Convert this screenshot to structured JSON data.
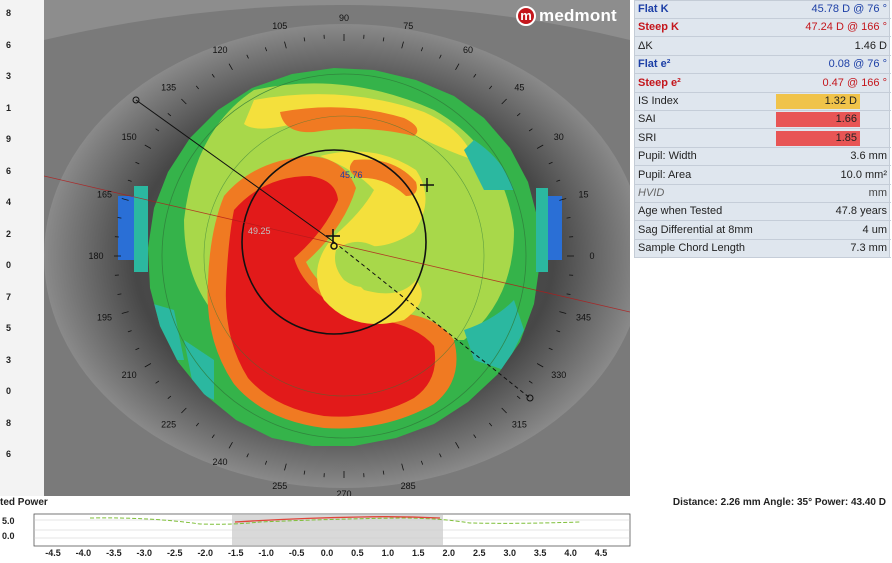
{
  "brand": {
    "logo_letter": "m",
    "name": "medmont"
  },
  "left_scale": [
    "8",
    "6",
    "3",
    "1",
    "9",
    "6",
    "4",
    "2",
    "0",
    "7",
    "5",
    "3",
    "0",
    "8",
    "6"
  ],
  "topography": {
    "axis_degrees": [
      "90",
      "105",
      "75",
      "120",
      "60",
      "135",
      "45",
      "150",
      "30",
      "165",
      "15",
      "180",
      "0",
      "195",
      "345",
      "210",
      "330",
      "225",
      "315",
      "240",
      "255",
      "270",
      "285"
    ],
    "value_labels": [
      "45.76",
      "49.25"
    ],
    "colors": {
      "red": "#e21a1a",
      "orange": "#f07a22",
      "yellow": "#f4e03c",
      "light_green": "#a8d84a",
      "green": "#35b34a",
      "teal": "#2bb8a0",
      "blue": "#2a6fd6"
    }
  },
  "stats": [
    {
      "label": "Flat K",
      "value": "45.78 D @ 76 °",
      "label_color": "#1c3fa6",
      "value_color": "#1c3fa6",
      "bold": true
    },
    {
      "label": "Steep K",
      "value": "47.24 D @ 166 °",
      "label_color": "#c4161c",
      "value_color": "#c4161c",
      "bold": true
    },
    {
      "label": "ΔK",
      "value": "1.46 D",
      "label_color": "#222222",
      "value_color": "#222222",
      "bold": false
    },
    {
      "label": "Flat e²",
      "value": "0.08 @ 76 °",
      "label_color": "#1c3fa6",
      "value_color": "#1c3fa6",
      "bold": true
    },
    {
      "label": "Steep e²",
      "value": "0.47 @ 166 °",
      "label_color": "#c4161c",
      "value_color": "#c4161c",
      "bold": true
    },
    {
      "label": "IS Index",
      "value": "1.32 D",
      "label_color": "#222222",
      "value_color": "#222222",
      "bold": false,
      "bar_color": "#f0c34a"
    },
    {
      "label": "SAI",
      "value": "1.66",
      "label_color": "#222222",
      "value_color": "#222222",
      "bold": false,
      "bar_color": "#e85555"
    },
    {
      "label": "SRI",
      "value": "1.85",
      "label_color": "#222222",
      "value_color": "#222222",
      "bold": false,
      "bar_color": "#e85555"
    },
    {
      "label": "Pupil: Width",
      "value": "3.6 mm",
      "label_color": "#222222",
      "value_color": "#222222",
      "bold": false
    },
    {
      "label": "Pupil: Area",
      "value": "10.0 mm²",
      "label_color": "#222222",
      "value_color": "#222222",
      "bold": false
    },
    {
      "label": "HVID",
      "value": "mm",
      "label_color": "#666666",
      "value_color": "#444444",
      "bold": false,
      "italic": true
    },
    {
      "label": "Age when Tested",
      "value": "47.8 years",
      "label_color": "#222222",
      "value_color": "#222222",
      "bold": false
    },
    {
      "label": "Sag Differential at 8mm",
      "value": "4 um",
      "label_color": "#222222",
      "value_color": "#222222",
      "bold": false
    },
    {
      "label": "Sample Chord Length",
      "value": "7.3 mm",
      "label_color": "#222222",
      "value_color": "#222222",
      "bold": false
    }
  ],
  "bottom_plot": {
    "title": "ted Power",
    "readout": "Distance: 2.26 mm Angle: 35° Power:  43.40 D",
    "y_labels": [
      "5.0",
      "0.0"
    ],
    "x_ticks": [
      "-4.5",
      "-4.0",
      "-3.5",
      "-3.0",
      "-2.5",
      "-2.0",
      "-1.5",
      "-1.0",
      "-0.5",
      "0.0",
      "0.5",
      "1.0",
      "1.5",
      "2.0",
      "2.5",
      "3.0",
      "3.5",
      "4.0",
      "4.5"
    ]
  }
}
